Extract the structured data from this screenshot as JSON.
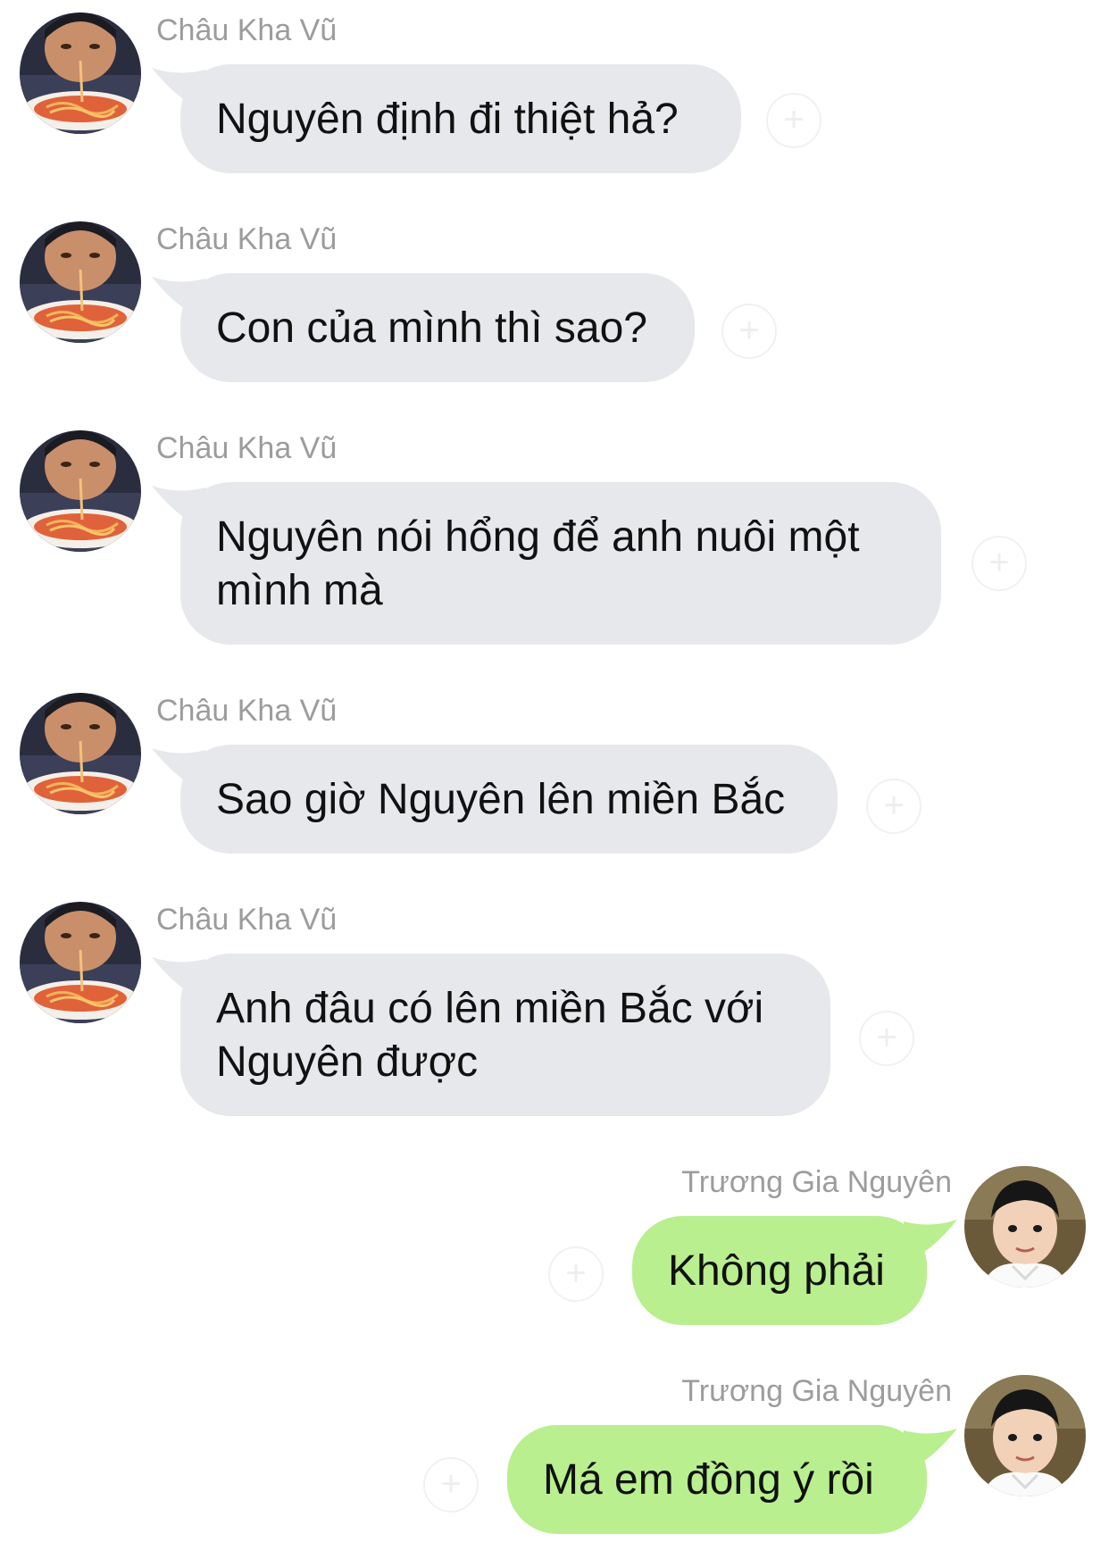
{
  "messages": [
    {
      "sender": "Châu Kha Vũ",
      "text": "Nguyên định đi thiệt hả?",
      "direction": "incoming"
    },
    {
      "sender": "Châu Kha Vũ",
      "text": "Con của mình thì sao?",
      "direction": "incoming"
    },
    {
      "sender": "Châu Kha Vũ",
      "text": "Nguyên nói hổng để anh nuôi một\nmình mà",
      "direction": "incoming"
    },
    {
      "sender": "Châu Kha Vũ",
      "text": "Sao giờ Nguyên lên miền Bắc",
      "direction": "incoming"
    },
    {
      "sender": "Châu Kha Vũ",
      "text": "Anh đâu có lên miền Bắc với\nNguyên được",
      "direction": "incoming"
    },
    {
      "sender": "Trương Gia Nguyên",
      "text": "Không phải",
      "direction": "outgoing"
    },
    {
      "sender": "Trương Gia Nguyên",
      "text": "Má em đồng ý rồi",
      "direction": "outgoing"
    }
  ],
  "icons": {
    "reaction": "add-reaction-icon",
    "incoming_avatar": "avatar-photo-eating-noodles",
    "outgoing_avatar": "avatar-photo-child"
  },
  "colors": {
    "incoming_bubble": "#e6e8ec",
    "outgoing_bubble": "#b9ef8f",
    "sender_name": "#9c9c9c",
    "message_text": "#111111"
  }
}
